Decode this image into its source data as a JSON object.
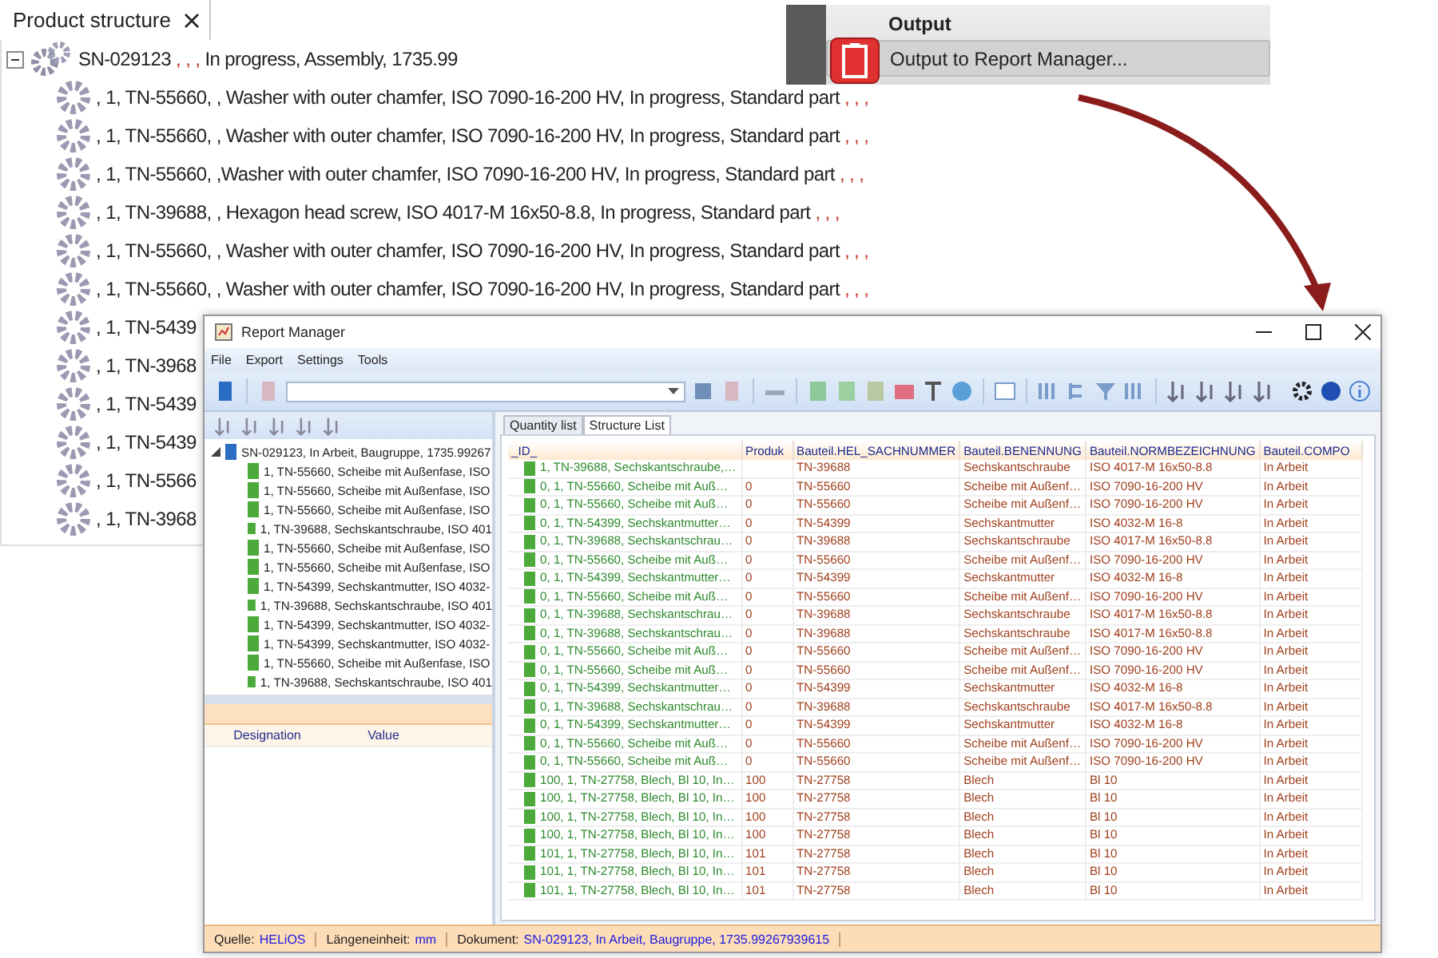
{
  "product_panel": {
    "tab": {
      "label": "Product structure",
      "selected": true
    },
    "tree": [
      {
        "expanded": true,
        "segments": [
          {
            "kind": "value",
            "text": "SN-029123"
          },
          {
            "kind": "empty",
            "text": ", , ,"
          },
          {
            "kind": "value",
            "text": "In progress, Assembly, 1735.99"
          }
        ],
        "children": [
          {
            "segments": [
              {
                "kind": "value",
                "text": ", 1, TN-55660, , Washer with outer chamfer, ISO 7090-16-200 HV, In progress, Standard part"
              },
              {
                "kind": "empty",
                "text": ", , ,"
              }
            ]
          },
          {
            "segments": [
              {
                "kind": "value",
                "text": ", 1, TN-55660, , Washer with outer chamfer, ISO 7090-16-200 HV, In progress, Standard part"
              },
              {
                "kind": "empty",
                "text": ", , ,"
              }
            ]
          },
          {
            "segments": [
              {
                "kind": "value",
                "text": ", 1, TN-55660, ,Washer with outer chamfer, ISO 7090-16-200 HV, In progress, Standard part"
              },
              {
                "kind": "empty",
                "text": ", , ,"
              }
            ]
          },
          {
            "segments": [
              {
                "kind": "value",
                "text": ", 1, TN-39688, , Hexagon head screw, ISO 4017-M 16x50-8.8, In progress, Standard part"
              },
              {
                "kind": "empty",
                "text": ", , ,"
              }
            ]
          },
          {
            "segments": [
              {
                "kind": "value",
                "text": ", 1, TN-55660, , Washer with outer chamfer, ISO 7090-16-200 HV, In progress, Standard part"
              },
              {
                "kind": "empty",
                "text": ", , ,"
              }
            ]
          },
          {
            "segments": [
              {
                "kind": "value",
                "text": ", 1, TN-55660, , Washer with outer chamfer, ISO 7090-16-200 HV, In progress, Standard part"
              },
              {
                "kind": "empty",
                "text": ", , ,"
              }
            ]
          },
          {
            "segments": [
              {
                "kind": "value",
                "text": ", 1, TN-5439"
              }
            ]
          },
          {
            "segments": [
              {
                "kind": "value",
                "text": ", 1, TN-3968"
              }
            ]
          },
          {
            "segments": [
              {
                "kind": "value",
                "text": ", 1, TN-5439"
              }
            ]
          },
          {
            "segments": [
              {
                "kind": "value",
                "text": ", 1, TN-5439"
              }
            ]
          },
          {
            "segments": [
              {
                "kind": "value",
                "text": ", 1, TN-5566"
              }
            ]
          },
          {
            "segments": [
              {
                "kind": "value",
                "text": ", 1, TN-3968"
              }
            ]
          }
        ]
      }
    ]
  },
  "output_panel": {
    "title": "Output",
    "items": [
      {
        "label": "Output to Report Manager..."
      }
    ]
  },
  "report_manager": {
    "title": "Report Manager",
    "menu": [
      "File",
      "Export",
      "Settings",
      "Tools"
    ],
    "tree": [
      {
        "expanded": true,
        "label": "SN-029123, In Arbeit, Baugruppe, 1735.99267",
        "children": [
          {
            "label": "1, TN-55660, Scheibe mit Außenfase, ISO"
          },
          {
            "label": "1, TN-55660, Scheibe mit Außenfase, ISO"
          },
          {
            "label": "1, TN-55660, Scheibe mit Außenfase, ISO"
          },
          {
            "label": "1, TN-39688, Sechskantschraube, ISO 401"
          },
          {
            "label": "1, TN-55660, Scheibe mit Außenfase, ISO"
          },
          {
            "label": "1, TN-55660, Scheibe mit Außenfase, ISO"
          },
          {
            "label": "1, TN-54399, Sechskantmutter, ISO 4032-"
          },
          {
            "label": "1, TN-39688, Sechskantschraube, ISO 401"
          },
          {
            "label": "1, TN-54399, Sechskantmutter, ISO 4032-"
          },
          {
            "label": "1, TN-54399, Sechskantmutter, ISO 4032-"
          },
          {
            "label": "1, TN-55660, Scheibe mit Außenfase, ISO"
          },
          {
            "label": "1, TN-39688, Sechskantschraube, ISO 401"
          }
        ]
      }
    ],
    "properties": {
      "columns": [
        "Designation",
        "Value"
      ]
    },
    "tabs": [
      {
        "label": "Quantity list",
        "selected": false
      },
      {
        "label": "Structure List",
        "selected": true
      }
    ],
    "table": {
      "columns": [
        "_ID_",
        "Produk",
        "Bauteil.HEL_SACHNUMMER",
        "Bauteil.BENENNUNG",
        "Bauteil.NORMBEZEICHNUNG",
        "Bauteil.COMPO"
      ],
      "rows": [
        [
          "1, TN-39688, Sechskantschraube,…",
          null,
          "TN-39688",
          "Sechskantschraube",
          "ISO 4017-M 16x50-8.8",
          "In Arbeit"
        ],
        [
          "0, 1, TN-55660, Scheibe mit Auß…",
          "0",
          "TN-55660",
          "Scheibe mit Außenf…",
          "ISO 7090-16-200 HV",
          "In Arbeit"
        ],
        [
          "0, 1, TN-55660, Scheibe mit Auß…",
          "0",
          "TN-55660",
          "Scheibe mit Außenf…",
          "ISO 7090-16-200 HV",
          "In Arbeit"
        ],
        [
          "0, 1, TN-54399, Sechskantmutter…",
          "0",
          "TN-54399",
          "Sechskantmutter",
          "ISO 4032-M 16-8",
          "In Arbeit"
        ],
        [
          "0, 1, TN-39688, Sechskantschrau…",
          "0",
          "TN-39688",
          "Sechskantschraube",
          "ISO 4017-M 16x50-8.8",
          "In Arbeit"
        ],
        [
          "0, 1, TN-55660, Scheibe mit Auß…",
          "0",
          "TN-55660",
          "Scheibe mit Außenf…",
          "ISO 7090-16-200 HV",
          "In Arbeit"
        ],
        [
          "0, 1, TN-54399, Sechskantmutter…",
          "0",
          "TN-54399",
          "Sechskantmutter",
          "ISO 4032-M 16-8",
          "In Arbeit"
        ],
        [
          "0, 1, TN-55660, Scheibe mit Auß…",
          "0",
          "TN-55660",
          "Scheibe mit Außenf…",
          "ISO 7090-16-200 HV",
          "In Arbeit"
        ],
        [
          "0, 1, TN-39688, Sechskantschrau…",
          "0",
          "TN-39688",
          "Sechskantschraube",
          "ISO 4017-M 16x50-8.8",
          "In Arbeit"
        ],
        [
          "0, 1, TN-39688, Sechskantschrau…",
          "0",
          "TN-39688",
          "Sechskantschraube",
          "ISO 4017-M 16x50-8.8",
          "In Arbeit"
        ],
        [
          "0, 1, TN-55660, Scheibe mit Auß…",
          "0",
          "TN-55660",
          "Scheibe mit Außenf…",
          "ISO 7090-16-200 HV",
          "In Arbeit"
        ],
        [
          "0, 1, TN-55660, Scheibe mit Auß…",
          "0",
          "TN-55660",
          "Scheibe mit Außenf…",
          "ISO 7090-16-200 HV",
          "In Arbeit"
        ],
        [
          "0, 1, TN-54399, Sechskantmutter…",
          "0",
          "TN-54399",
          "Sechskantmutter",
          "ISO 4032-M 16-8",
          "In Arbeit"
        ],
        [
          "0, 1, TN-39688, Sechskantschrau…",
          "0",
          "TN-39688",
          "Sechskantschraube",
          "ISO 4017-M 16x50-8.8",
          "In Arbeit"
        ],
        [
          "0, 1, TN-54399, Sechskantmutter…",
          "0",
          "TN-54399",
          "Sechskantmutter",
          "ISO 4032-M 16-8",
          "In Arbeit"
        ],
        [
          "0, 1, TN-55660, Scheibe mit Auß…",
          "0",
          "TN-55660",
          "Scheibe mit Außenf…",
          "ISO 7090-16-200 HV",
          "In Arbeit"
        ],
        [
          "0, 1, TN-55660, Scheibe mit Auß…",
          "0",
          "TN-55660",
          "Scheibe mit Außenf…",
          "ISO 7090-16-200 HV",
          "In Arbeit"
        ],
        [
          "100, 1, TN-27758, Blech, Bl 10, In…",
          "100",
          "TN-27758",
          "Blech",
          "Bl 10",
          "In Arbeit"
        ],
        [
          "100, 1, TN-27758, Blech, Bl 10, In…",
          "100",
          "TN-27758",
          "Blech",
          "Bl 10",
          "In Arbeit"
        ],
        [
          "100, 1, TN-27758, Blech, Bl 10, In…",
          "100",
          "TN-27758",
          "Blech",
          "Bl 10",
          "In Arbeit"
        ],
        [
          "100, 1, TN-27758, Blech, Bl 10, In…",
          "100",
          "TN-27758",
          "Blech",
          "Bl 10",
          "In Arbeit"
        ],
        [
          "101, 1, TN-27758, Blech, Bl 10, In…",
          "101",
          "TN-27758",
          "Blech",
          "Bl 10",
          "In Arbeit"
        ],
        [
          "101, 1, TN-27758, Blech, Bl 10, In…",
          "101",
          "TN-27758",
          "Blech",
          "Bl 10",
          "In Arbeit"
        ],
        [
          "101, 1, TN-27758, Blech, Bl 10, In…",
          "101",
          "TN-27758",
          "Blech",
          "Bl 10",
          "In Arbeit"
        ]
      ]
    },
    "status_bar": [
      {
        "label": "Quelle:",
        "value": "HELiOS"
      },
      {
        "label": "Längeneinheit:",
        "value": "mm"
      },
      {
        "label": "Dokument:",
        "value": "SN-029123, In Arbeit, Baugruppe, 1735.99267939615"
      }
    ]
  }
}
